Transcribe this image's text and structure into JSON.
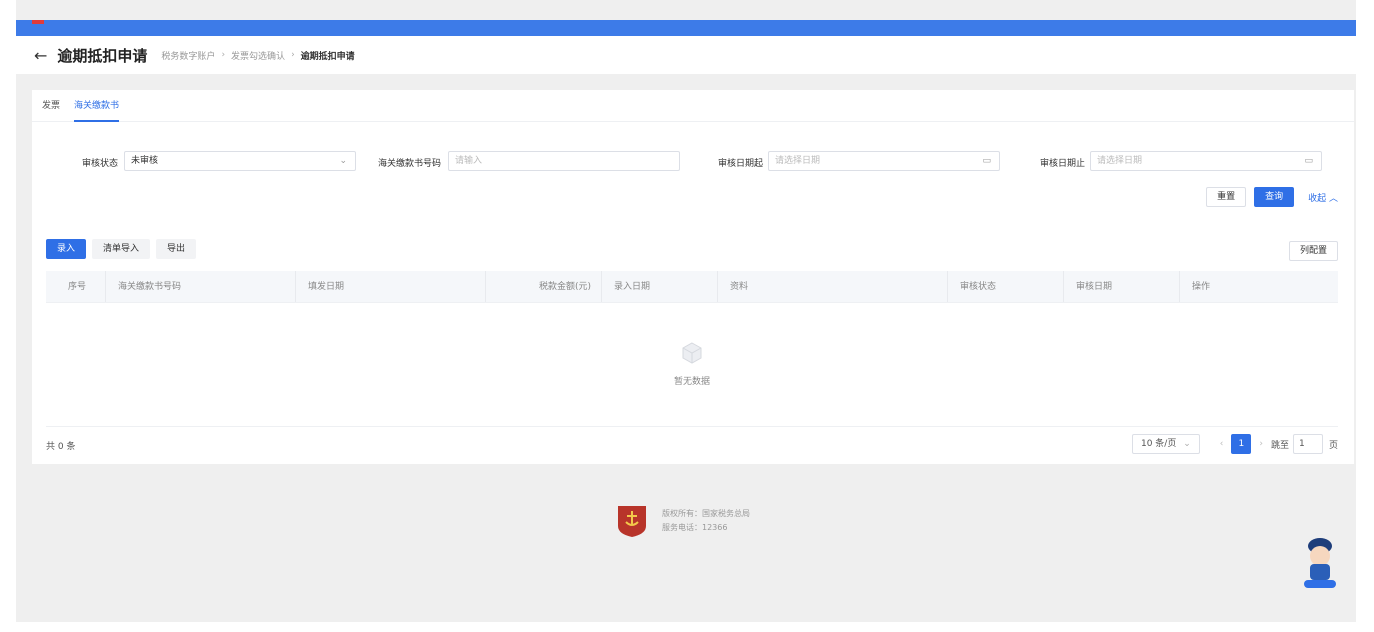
{
  "header": {
    "back_icon": "arrow-left-icon",
    "title": "逾期抵扣申请",
    "breadcrumb": [
      "税务数字账户",
      "发票勾选确认",
      "逾期抵扣申请"
    ]
  },
  "tabs": [
    {
      "label": "发票",
      "active": false
    },
    {
      "label": "海关缴款书",
      "active": true
    }
  ],
  "filters": {
    "status_label": "审核状态",
    "status_value": "未审核",
    "bill_no_label": "海关缴款书号码",
    "bill_no_placeholder": "请输入",
    "date_from_label": "审核日期起",
    "date_from_placeholder": "请选择日期",
    "date_to_label": "审核日期止",
    "date_to_placeholder": "请选择日期"
  },
  "filter_buttons": {
    "reset": "重置",
    "query": "查询",
    "collapse": "收起"
  },
  "actions": {
    "enter": "录入",
    "list_import": "清单导入",
    "export": "导出",
    "column_config": "列配置"
  },
  "table": {
    "columns": [
      "序号",
      "海关缴款书号码",
      "填发日期",
      "税款金额(元)",
      "录入日期",
      "资料",
      "审核状态",
      "审核日期",
      "操作"
    ],
    "empty_text": "暂无数据"
  },
  "pagination": {
    "total": "共 0 条",
    "page_size": "10 条/页",
    "current_page": "1",
    "jump_label": "跳至",
    "jump_value": "1",
    "page_suffix": "页"
  },
  "footer": {
    "copyright": "版权所有：国家税务总局",
    "phone": "服务电话：12366"
  },
  "colors": {
    "primary": "#2f6fe6",
    "topbar": "#3d7be8",
    "emblem": "#b8342a"
  }
}
